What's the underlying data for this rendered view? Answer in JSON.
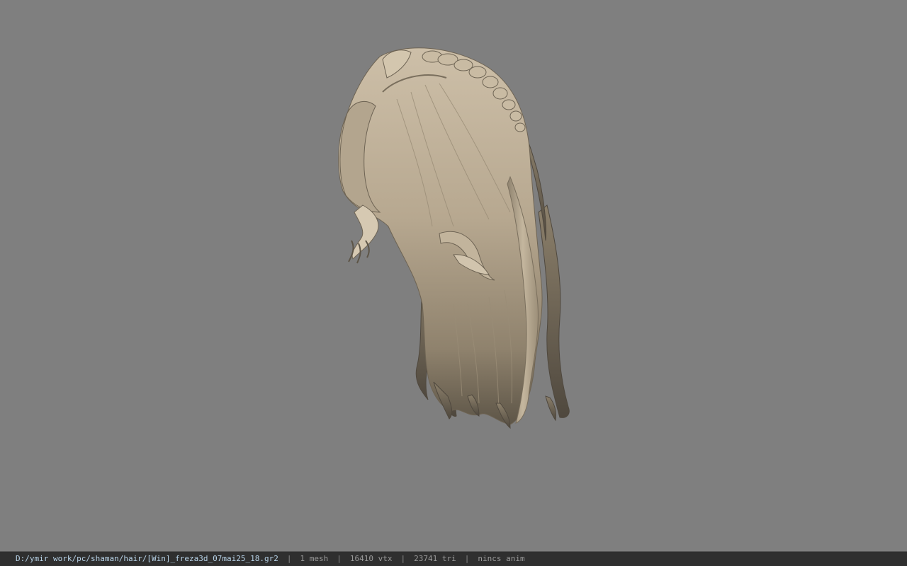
{
  "viewport": {
    "background_color": "#7f7f7f",
    "model_colors": {
      "hair_light": "#cdbfa8",
      "hair_mid": "#a89a84",
      "hair_dark": "#6e6454",
      "hair_shadow": "#4f483e"
    }
  },
  "status_bar": {
    "file_path": "D:/ymir work/pc/shaman/hair/[Win]_freza3d_07mai25_18.gr2",
    "separator": "|",
    "mesh_count": "1 mesh",
    "vertex_count": "16410 vtx",
    "triangle_count": "23741 tri",
    "anim_status": "nincs anim"
  }
}
